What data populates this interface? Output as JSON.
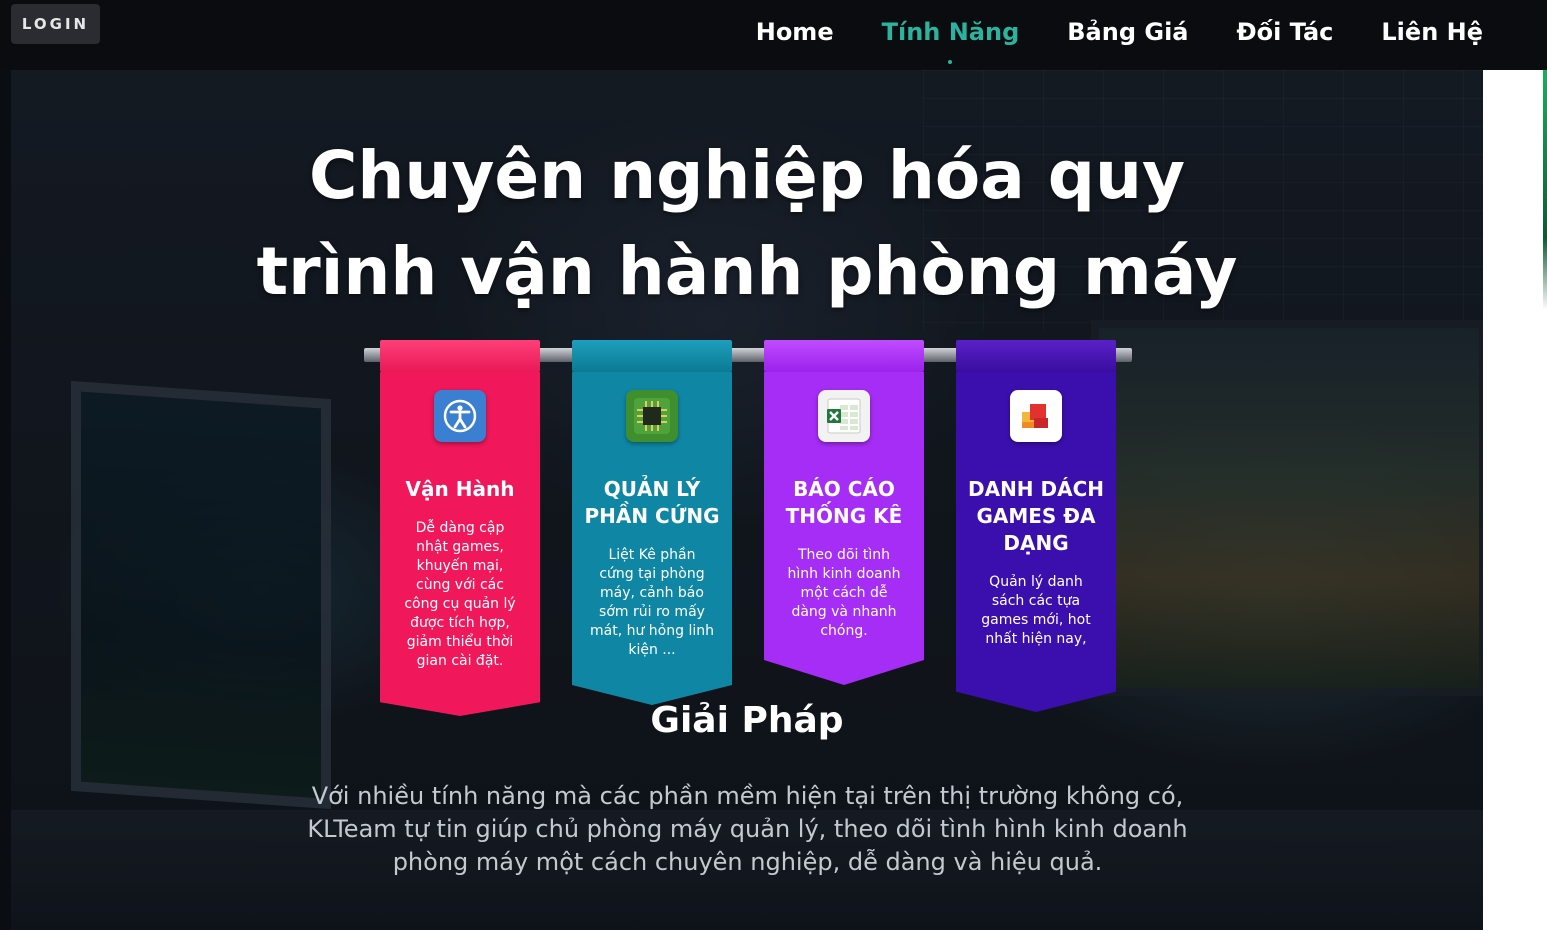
{
  "nav": {
    "login_label": "LOGIN",
    "links": [
      "Home",
      "Tính Năng",
      "Bảng Giá",
      "Đối Tác",
      "Liên Hệ"
    ],
    "active_index": 1
  },
  "hero": {
    "headline_line1": "Chuyên nghiệp hóa quy",
    "headline_line2": "trình vận hành phòng máy"
  },
  "features": [
    {
      "title": "Vận Hành",
      "desc": "Dễ dàng cập nhật games, khuyến mại, cùng với các công cụ quản lý được tích hợp, giảm thiểu thời gian cài đặt.",
      "icon": "accessibility-icon",
      "color": "#f0185a"
    },
    {
      "title": "QUẢN LÝ PHẦN CỨNG",
      "desc": "Liệt Kê phần cứng tại phòng máy, cảnh báo sớm rủi ro mấy mát, hư hỏng linh kiện ...",
      "icon": "chip-icon",
      "color": "#0f87a4"
    },
    {
      "title": "BÁO CÁO THỐNG KÊ",
      "desc": "Theo dõi tình hình kinh doanh một cách dễ dàng và nhanh chóng.",
      "icon": "excel-icon",
      "color": "#a62df5"
    },
    {
      "title": "DANH DÁCH GAMES ĐA DẠNG",
      "desc": "Quản lý danh sách các tựa games mới, hot nhất hiện nay,",
      "icon": "office-icon",
      "color": "#3b0fad"
    }
  ],
  "solution": {
    "title": "Giải Pháp",
    "desc": "Với nhiều tính năng mà các phần mềm hiện tại trên thị trường không có, KLTeam tự tin giúp chủ phòng máy quản lý, theo dõi tình hình kinh doanh phòng máy một cách chuyên nghiệp, dễ dàng và hiệu quả."
  }
}
